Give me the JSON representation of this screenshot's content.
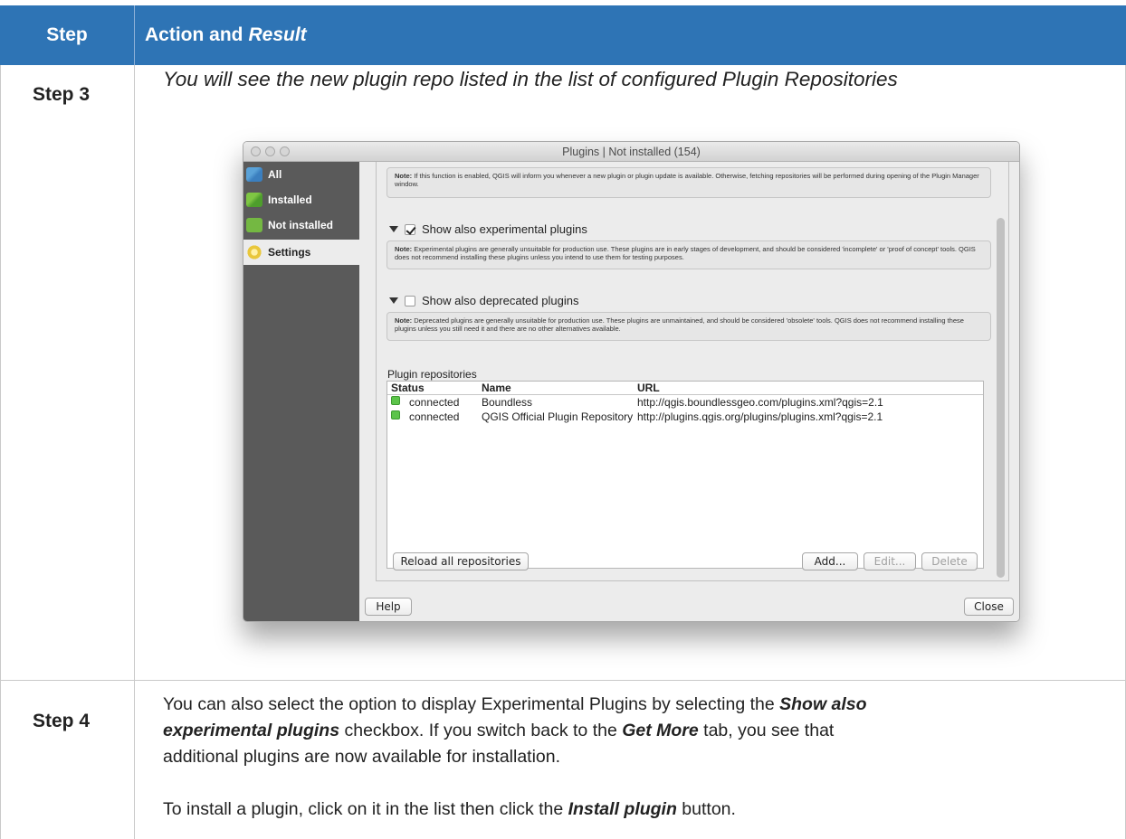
{
  "header": {
    "step_col": "Step",
    "action_col": "Action and",
    "action_col_italic": "Result"
  },
  "step3": {
    "label": "Step 3",
    "result": "You will see the new plugin repo listed in the list of configured Plugin Repositories"
  },
  "window": {
    "title": "Plugins | Not installed (154)",
    "sidebar": [
      {
        "label": "All",
        "icon": "all-plugins-icon"
      },
      {
        "label": "Installed",
        "icon": "installed-plugins-icon"
      },
      {
        "label": "Not installed",
        "icon": "not-installed-plugins-icon"
      },
      {
        "label": "Settings",
        "icon": "settings-gear-icon"
      }
    ],
    "note_top": {
      "bold": "Note:",
      "text": " If this function is enabled, QGIS will inform you whenever a new plugin or plugin update is available. Otherwise, fetching repositories will be performed during opening of the Plugin Manager window."
    },
    "experimental": {
      "label": "Show also experimental plugins",
      "checked": true,
      "note_bold": "Note:",
      "note_text": " Experimental plugins are generally unsuitable for production use. These plugins are in early stages of development, and should be considered 'incomplete' or 'proof of concept' tools. QGIS does not recommend installing these plugins unless you intend to use them for testing purposes."
    },
    "deprecated": {
      "label": "Show also deprecated plugins",
      "checked": false,
      "note_bold": "Note:",
      "note_text": " Deprecated plugins are generally unsuitable for production use. These plugins are unmaintained, and should be considered 'obsolete' tools. QGIS does not recommend installing these plugins unless you still need it and there are no other alternatives available."
    },
    "repos_label": "Plugin repositories",
    "repo_columns": {
      "status": "Status",
      "name": "Name",
      "url": "URL"
    },
    "repos": [
      {
        "status": "connected",
        "name": "Boundless",
        "url": "http://qgis.boundlessgeo.com/plugins.xml?qgis=2.1"
      },
      {
        "status": "connected",
        "name": "QGIS Official Plugin Repository",
        "url": "http://plugins.qgis.org/plugins/plugins.xml?qgis=2.1"
      }
    ],
    "buttons": {
      "reload": "Reload all repositories",
      "add": "Add...",
      "edit": "Edit...",
      "delete": "Delete",
      "help": "Help",
      "close": "Close"
    }
  },
  "step4": {
    "label": "Step 4",
    "p1_a": "You can also select the option to display Experimental Plugins by selecting the ",
    "p1_b": "Show also",
    "p1_c": "experimental plugins",
    "p1_d": " checkbox. If you switch back to the ",
    "p1_e": "Get More",
    "p1_f": " tab, you see that",
    "p1_g": "additional plugins are now available for installation.",
    "p2_a": "To install a plugin, click on it in the list then click the ",
    "p2_b": "Install plugin",
    "p2_c": " button."
  },
  "colors": {
    "header_bg": "#2e74b5",
    "status_connected": "#5cc44a"
  }
}
